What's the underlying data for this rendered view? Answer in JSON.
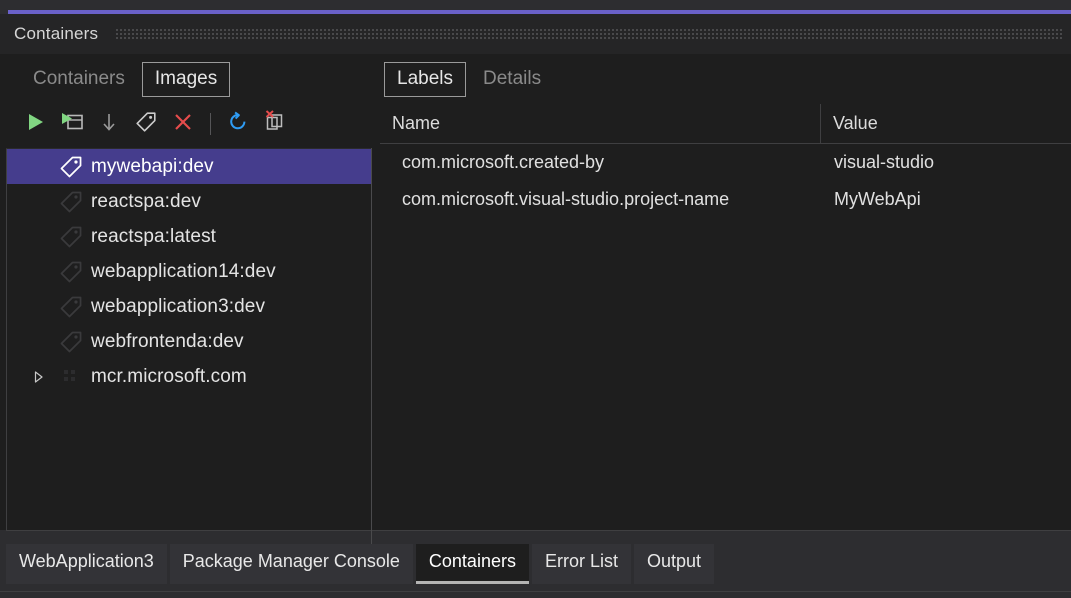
{
  "window": {
    "title": "Containers",
    "accent_color": "#6a61c9",
    "background": "#1e1e1e",
    "selection_color": "#453d8d"
  },
  "left_pane": {
    "tabs": [
      {
        "label": "Containers",
        "selected": false
      },
      {
        "label": "Images",
        "selected": true
      }
    ],
    "toolbar": [
      {
        "name": "run-icon",
        "title": "Run",
        "color": "#81d682"
      },
      {
        "name": "run-interactive-icon",
        "title": "Run Interactive",
        "color": "#81d682"
      },
      {
        "name": "pull-icon",
        "title": "Pull",
        "color": "#9a9a9a"
      },
      {
        "name": "tag-icon",
        "title": "Tag",
        "color": "#c8c8c8"
      },
      {
        "name": "remove-icon",
        "title": "Remove",
        "color": "#e74c4c"
      },
      {
        "name": "separator",
        "title": "",
        "color": "#555557"
      },
      {
        "name": "refresh-icon",
        "title": "Refresh",
        "color": "#2f9cf4"
      },
      {
        "name": "prune-images-icon",
        "title": "Prune Images",
        "color": "#c8c8c8"
      }
    ],
    "images": [
      {
        "label": "mywebapi:dev",
        "icon": "tag-icon",
        "selected": true,
        "expandable": false
      },
      {
        "label": "reactspa:dev",
        "icon": "tag-icon",
        "selected": false,
        "expandable": false
      },
      {
        "label": "reactspa:latest",
        "icon": "tag-icon",
        "selected": false,
        "expandable": false
      },
      {
        "label": "webapplication14:dev",
        "icon": "tag-icon",
        "selected": false,
        "expandable": false
      },
      {
        "label": "webapplication3:dev",
        "icon": "tag-icon",
        "selected": false,
        "expandable": false
      },
      {
        "label": "webfrontenda:dev",
        "icon": "tag-icon",
        "selected": false,
        "expandable": false
      },
      {
        "label": "mcr.microsoft.com",
        "icon": "registry-group-icon",
        "selected": false,
        "expandable": true
      }
    ]
  },
  "right_pane": {
    "tabs": [
      {
        "label": "Labels",
        "selected": true
      },
      {
        "label": "Details",
        "selected": false
      }
    ],
    "grid": {
      "columns": [
        "Name",
        "Value"
      ],
      "rows": [
        {
          "name": "com.microsoft.created-by",
          "value": "visual-studio"
        },
        {
          "name": "com.microsoft.visual-studio.project-name",
          "value": "MyWebApi"
        }
      ]
    }
  },
  "dock": {
    "tabs": [
      {
        "label": "WebApplication3",
        "active": false
      },
      {
        "label": "Package Manager Console",
        "active": false
      },
      {
        "label": "Containers",
        "active": true
      },
      {
        "label": "Error List",
        "active": false
      },
      {
        "label": "Output",
        "active": false
      }
    ]
  }
}
